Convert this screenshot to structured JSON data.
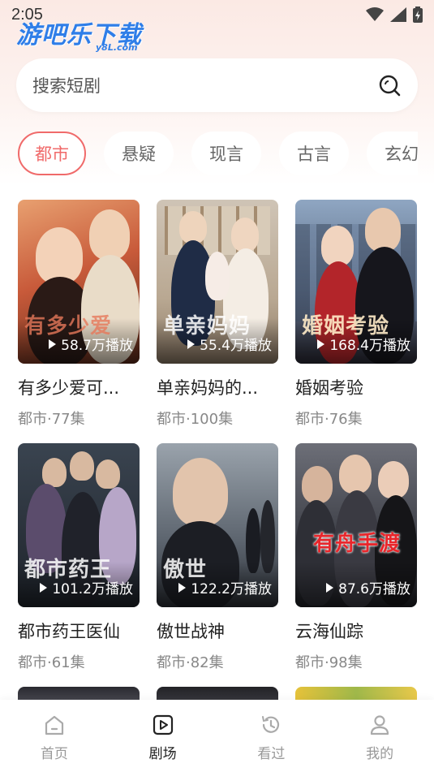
{
  "status_bar": {
    "time": "2:05"
  },
  "watermark": {
    "text": "游吧乐下载",
    "sub": "y8L.com"
  },
  "search": {
    "placeholder": "搜索短剧",
    "icon": "search-icon"
  },
  "tabs": [
    {
      "label": "都市",
      "active": true
    },
    {
      "label": "悬疑",
      "active": false
    },
    {
      "label": "现言",
      "active": false
    },
    {
      "label": "古言",
      "active": false
    },
    {
      "label": "玄幻",
      "active": false
    }
  ],
  "dramas": [
    {
      "title": "有多少爱可...",
      "meta": "都市·77集",
      "plays": "58.7万播放",
      "poster_text": "有多少爱"
    },
    {
      "title": "单亲妈妈的...",
      "meta": "都市·100集",
      "plays": "55.4万播放",
      "poster_text": "单亲妈妈"
    },
    {
      "title": "婚姻考验",
      "meta": "都市·76集",
      "plays": "168.4万播放",
      "poster_text": "婚姻考验"
    },
    {
      "title": "都市药王医仙",
      "meta": "都市·61集",
      "plays": "101.2万播放",
      "poster_text": "都市药王"
    },
    {
      "title": "傲世战神",
      "meta": "都市·82集",
      "plays": "122.2万播放",
      "poster_text": "傲世"
    },
    {
      "title": "云海仙踪",
      "meta": "都市·98集",
      "plays": "87.6万播放",
      "poster_text": "有舟手渡"
    }
  ],
  "bottom_nav": [
    {
      "label": "首页",
      "icon": "home-icon",
      "active": false
    },
    {
      "label": "剧场",
      "icon": "play-square-icon",
      "active": true
    },
    {
      "label": "看过",
      "icon": "history-icon",
      "active": false
    },
    {
      "label": "我的",
      "icon": "user-icon",
      "active": false
    }
  ],
  "colors": {
    "accent": "#f06a6a",
    "header_bg": "#fbe9e4"
  }
}
